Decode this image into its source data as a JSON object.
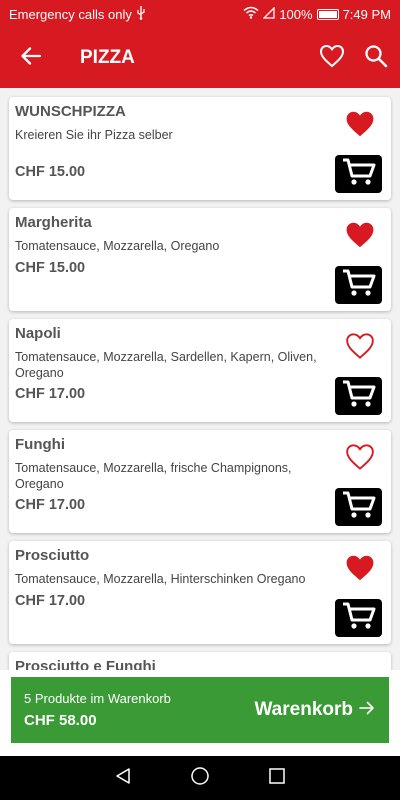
{
  "status_bar": {
    "left_text": "Emergency calls only",
    "battery": "100%",
    "time": "7:49 PM"
  },
  "app_bar": {
    "title": "PIZZA"
  },
  "colors": {
    "brand_red": "#d71921",
    "basket_green": "#3a9a35",
    "cart_button": "#000000"
  },
  "products": [
    {
      "name": "WUNSCHPIZZA",
      "description": "Kreieren Sie ihr Pizza selber",
      "price": "CHF 15.00",
      "favorite": true
    },
    {
      "name": "Margherita",
      "description": "Tomatensauce, Mozzarella, Oregano",
      "price": "CHF 15.00",
      "favorite": true
    },
    {
      "name": "Napoli",
      "description": "Tomatensauce, Mozzarella, Sardellen, Kapern, Oliven, Oregano",
      "price": "CHF 17.00",
      "favorite": false
    },
    {
      "name": "Funghi",
      "description": "Tomatensauce, Mozzarella, frische Champignons, Oregano",
      "price": "CHF 17.00",
      "favorite": false
    },
    {
      "name": "Prosciutto",
      "description": "Tomatensauce, Mozzarella, Hinterschinken Oregano",
      "price": "CHF 17.00",
      "favorite": true
    },
    {
      "name": "Prosciutto e Funghi"
    }
  ],
  "basket": {
    "count_text": "5 Produkte im Warenkorb",
    "total": "CHF 58.00",
    "action_label": "Warenkorb"
  }
}
